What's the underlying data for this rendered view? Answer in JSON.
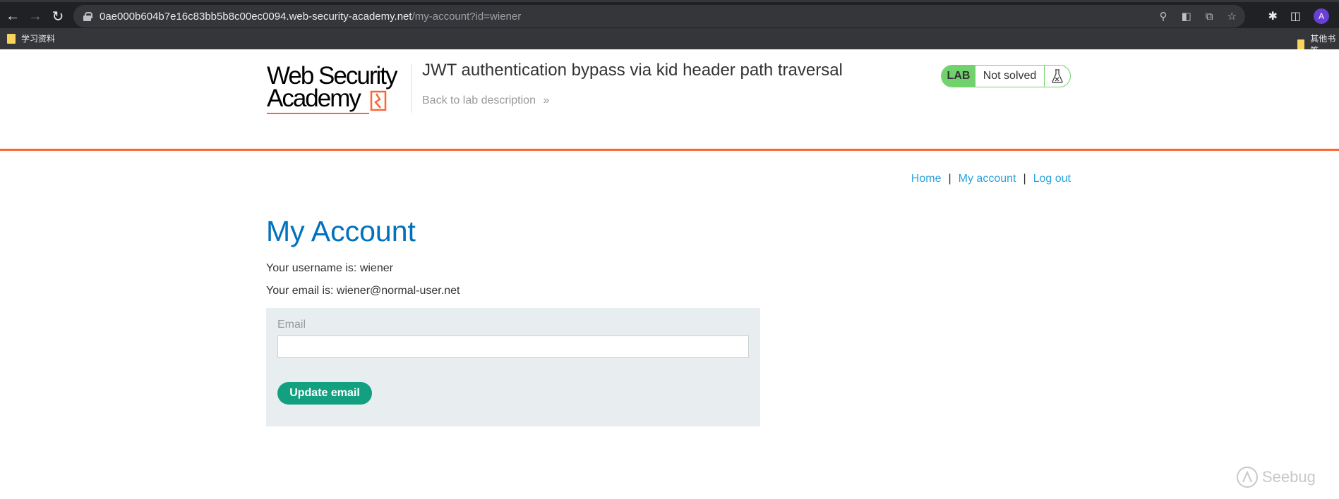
{
  "browser": {
    "url_host": "0ae000b604b7e16c83bb5b8c00ec0094.web-security-academy.net",
    "url_path": "/my-account?id=wiener",
    "avatar_letter": "A",
    "bookmarks": {
      "left_folder": "学习资料",
      "right_folder": "其他书签"
    }
  },
  "header": {
    "logo_line1": "Web Security",
    "logo_line2": "Academy",
    "lab_title": "JWT authentication bypass via kid header path traversal",
    "back_link": "Back to lab description",
    "badge_lab": "LAB",
    "badge_status": "Not solved"
  },
  "nav": {
    "home": "Home",
    "separator": "|",
    "my_account": "My account",
    "log_out": "Log out"
  },
  "main": {
    "title": "My Account",
    "username_line": "Your username is: wiener",
    "email_line": "Your email is: wiener@normal-user.net",
    "form": {
      "email_label": "Email",
      "email_value": "",
      "submit_label": "Update email"
    }
  },
  "watermark": "Seebug",
  "colors": {
    "accent_orange": "#ff6633",
    "link_blue": "#29a3dd",
    "title_blue": "#0071bc",
    "lab_green": "#70d16d",
    "button_green": "#12a081",
    "form_bg": "#e8eef0"
  }
}
